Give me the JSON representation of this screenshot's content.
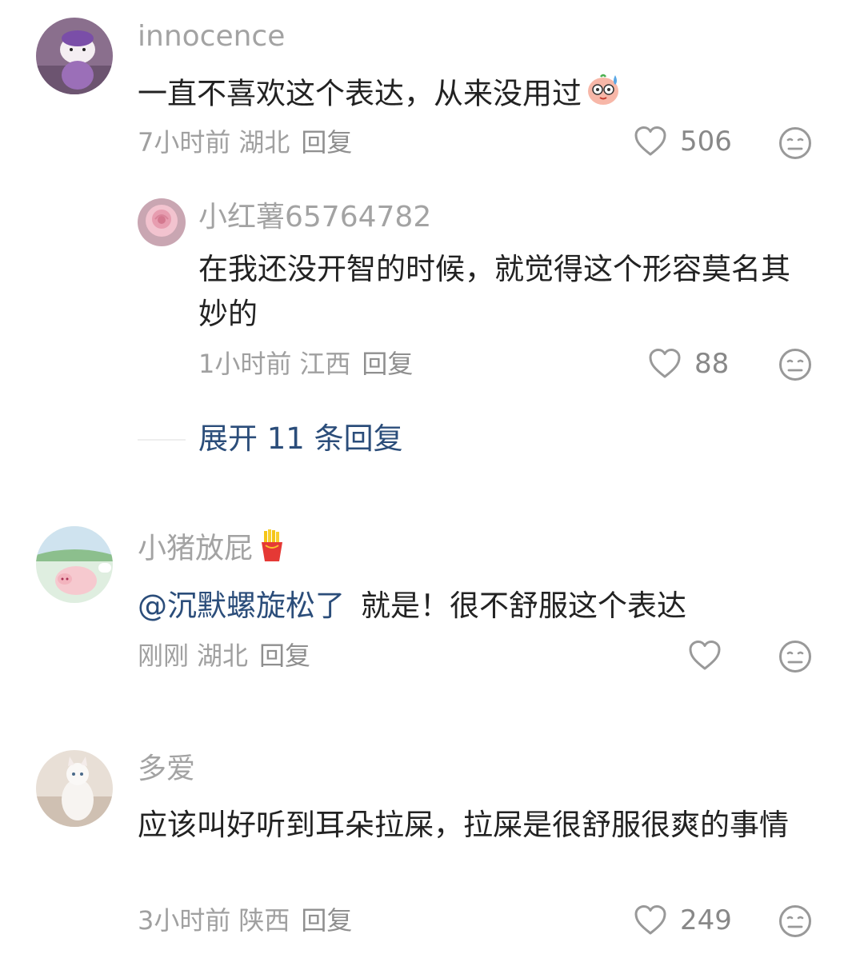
{
  "comments": [
    {
      "username": "innocence",
      "text": "一直不喜欢这个表达，从来没用过",
      "emoji": "sweat-face-emoji",
      "time": "7小时前",
      "location": "湖北",
      "reply_label": "回复",
      "likes": "506",
      "replies": [
        {
          "username": "小红薯65764782",
          "text": "在我还没开智的时候，就觉得这个形容莫名其妙的",
          "time": "1小时前",
          "location": "江西",
          "reply_label": "回复",
          "likes": "88"
        }
      ],
      "expand_label": "展开 11 条回复"
    },
    {
      "username": "小猪放屁",
      "name_emoji": "fries-emoji",
      "mention": "@沉默螺旋松了",
      "text": "就是！很不舒服这个表达",
      "time": "刚刚",
      "location": "湖北",
      "reply_label": "回复",
      "likes": ""
    },
    {
      "username": "多爱",
      "text": "应该叫好听到耳朵拉屎，拉屎是很舒服很爽的事情",
      "time": "3小时前",
      "location": "陕西",
      "reply_label": "回复",
      "likes": "249"
    }
  ],
  "icons": {
    "like": "heart-outline-icon",
    "dislike": "meh-face-icon"
  },
  "colors": {
    "link": "#2b4d7a",
    "muted": "#a0a0a0",
    "text": "#222222"
  }
}
